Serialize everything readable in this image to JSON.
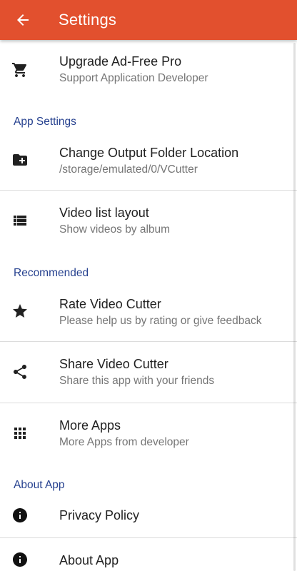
{
  "appbar": {
    "title": "Settings",
    "background": "#e2502e",
    "back_icon": "arrow-back-icon"
  },
  "upgrade": {
    "title": "Upgrade Ad-Free Pro",
    "subtitle": "Support Application Developer",
    "icon": "cart-icon"
  },
  "sections": {
    "app_settings": "App Settings",
    "recommended": "Recommended",
    "about_app": "About App"
  },
  "items": {
    "output_folder": {
      "title": "Change Output Folder Location",
      "subtitle": "/storage/emulated/0/VCutter",
      "icon": "folder-add-icon"
    },
    "video_layout": {
      "title": "Video list layout",
      "subtitle": "Show videos by album",
      "icon": "view-list-icon"
    },
    "rate": {
      "title": "Rate Video Cutter",
      "subtitle": "Please help us by rating or give feedback",
      "icon": "star-icon"
    },
    "share": {
      "title": "Share Video Cutter",
      "subtitle": "Share this app with your friends",
      "icon": "share-icon"
    },
    "more_apps": {
      "title": "More Apps",
      "subtitle": "More Apps from developer",
      "icon": "apps-grid-icon"
    },
    "privacy": {
      "title": "Privacy Policy",
      "icon": "info-icon"
    },
    "about": {
      "title": "About App",
      "icon": "info-icon"
    }
  },
  "colors": {
    "accent": "#e2502e",
    "section_header": "#26418f",
    "primary_text": "#212121",
    "secondary_text": "#757575"
  }
}
